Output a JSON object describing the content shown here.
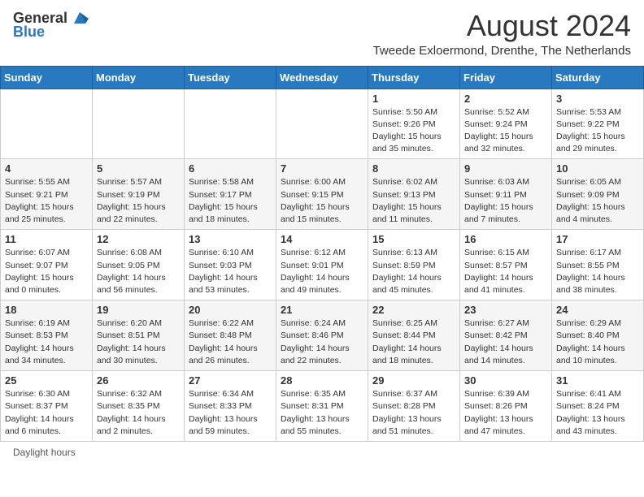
{
  "header": {
    "logo_general": "General",
    "logo_blue": "Blue",
    "main_title": "August 2024",
    "subtitle": "Tweede Exloermond, Drenthe, The Netherlands"
  },
  "days_of_week": [
    "Sunday",
    "Monday",
    "Tuesday",
    "Wednesday",
    "Thursday",
    "Friday",
    "Saturday"
  ],
  "weeks": [
    [
      {
        "day": "",
        "sunrise": "",
        "sunset": "",
        "daylight": ""
      },
      {
        "day": "",
        "sunrise": "",
        "sunset": "",
        "daylight": ""
      },
      {
        "day": "",
        "sunrise": "",
        "sunset": "",
        "daylight": ""
      },
      {
        "day": "",
        "sunrise": "",
        "sunset": "",
        "daylight": ""
      },
      {
        "day": "1",
        "sunrise": "Sunrise: 5:50 AM",
        "sunset": "Sunset: 9:26 PM",
        "daylight": "Daylight: 15 hours and 35 minutes."
      },
      {
        "day": "2",
        "sunrise": "Sunrise: 5:52 AM",
        "sunset": "Sunset: 9:24 PM",
        "daylight": "Daylight: 15 hours and 32 minutes."
      },
      {
        "day": "3",
        "sunrise": "Sunrise: 5:53 AM",
        "sunset": "Sunset: 9:22 PM",
        "daylight": "Daylight: 15 hours and 29 minutes."
      }
    ],
    [
      {
        "day": "4",
        "sunrise": "Sunrise: 5:55 AM",
        "sunset": "Sunset: 9:21 PM",
        "daylight": "Daylight: 15 hours and 25 minutes."
      },
      {
        "day": "5",
        "sunrise": "Sunrise: 5:57 AM",
        "sunset": "Sunset: 9:19 PM",
        "daylight": "Daylight: 15 hours and 22 minutes."
      },
      {
        "day": "6",
        "sunrise": "Sunrise: 5:58 AM",
        "sunset": "Sunset: 9:17 PM",
        "daylight": "Daylight: 15 hours and 18 minutes."
      },
      {
        "day": "7",
        "sunrise": "Sunrise: 6:00 AM",
        "sunset": "Sunset: 9:15 PM",
        "daylight": "Daylight: 15 hours and 15 minutes."
      },
      {
        "day": "8",
        "sunrise": "Sunrise: 6:02 AM",
        "sunset": "Sunset: 9:13 PM",
        "daylight": "Daylight: 15 hours and 11 minutes."
      },
      {
        "day": "9",
        "sunrise": "Sunrise: 6:03 AM",
        "sunset": "Sunset: 9:11 PM",
        "daylight": "Daylight: 15 hours and 7 minutes."
      },
      {
        "day": "10",
        "sunrise": "Sunrise: 6:05 AM",
        "sunset": "Sunset: 9:09 PM",
        "daylight": "Daylight: 15 hours and 4 minutes."
      }
    ],
    [
      {
        "day": "11",
        "sunrise": "Sunrise: 6:07 AM",
        "sunset": "Sunset: 9:07 PM",
        "daylight": "Daylight: 15 hours and 0 minutes."
      },
      {
        "day": "12",
        "sunrise": "Sunrise: 6:08 AM",
        "sunset": "Sunset: 9:05 PM",
        "daylight": "Daylight: 14 hours and 56 minutes."
      },
      {
        "day": "13",
        "sunrise": "Sunrise: 6:10 AM",
        "sunset": "Sunset: 9:03 PM",
        "daylight": "Daylight: 14 hours and 53 minutes."
      },
      {
        "day": "14",
        "sunrise": "Sunrise: 6:12 AM",
        "sunset": "Sunset: 9:01 PM",
        "daylight": "Daylight: 14 hours and 49 minutes."
      },
      {
        "day": "15",
        "sunrise": "Sunrise: 6:13 AM",
        "sunset": "Sunset: 8:59 PM",
        "daylight": "Daylight: 14 hours and 45 minutes."
      },
      {
        "day": "16",
        "sunrise": "Sunrise: 6:15 AM",
        "sunset": "Sunset: 8:57 PM",
        "daylight": "Daylight: 14 hours and 41 minutes."
      },
      {
        "day": "17",
        "sunrise": "Sunrise: 6:17 AM",
        "sunset": "Sunset: 8:55 PM",
        "daylight": "Daylight: 14 hours and 38 minutes."
      }
    ],
    [
      {
        "day": "18",
        "sunrise": "Sunrise: 6:19 AM",
        "sunset": "Sunset: 8:53 PM",
        "daylight": "Daylight: 14 hours and 34 minutes."
      },
      {
        "day": "19",
        "sunrise": "Sunrise: 6:20 AM",
        "sunset": "Sunset: 8:51 PM",
        "daylight": "Daylight: 14 hours and 30 minutes."
      },
      {
        "day": "20",
        "sunrise": "Sunrise: 6:22 AM",
        "sunset": "Sunset: 8:48 PM",
        "daylight": "Daylight: 14 hours and 26 minutes."
      },
      {
        "day": "21",
        "sunrise": "Sunrise: 6:24 AM",
        "sunset": "Sunset: 8:46 PM",
        "daylight": "Daylight: 14 hours and 22 minutes."
      },
      {
        "day": "22",
        "sunrise": "Sunrise: 6:25 AM",
        "sunset": "Sunset: 8:44 PM",
        "daylight": "Daylight: 14 hours and 18 minutes."
      },
      {
        "day": "23",
        "sunrise": "Sunrise: 6:27 AM",
        "sunset": "Sunset: 8:42 PM",
        "daylight": "Daylight: 14 hours and 14 minutes."
      },
      {
        "day": "24",
        "sunrise": "Sunrise: 6:29 AM",
        "sunset": "Sunset: 8:40 PM",
        "daylight": "Daylight: 14 hours and 10 minutes."
      }
    ],
    [
      {
        "day": "25",
        "sunrise": "Sunrise: 6:30 AM",
        "sunset": "Sunset: 8:37 PM",
        "daylight": "Daylight: 14 hours and 6 minutes."
      },
      {
        "day": "26",
        "sunrise": "Sunrise: 6:32 AM",
        "sunset": "Sunset: 8:35 PM",
        "daylight": "Daylight: 14 hours and 2 minutes."
      },
      {
        "day": "27",
        "sunrise": "Sunrise: 6:34 AM",
        "sunset": "Sunset: 8:33 PM",
        "daylight": "Daylight: 13 hours and 59 minutes."
      },
      {
        "day": "28",
        "sunrise": "Sunrise: 6:35 AM",
        "sunset": "Sunset: 8:31 PM",
        "daylight": "Daylight: 13 hours and 55 minutes."
      },
      {
        "day": "29",
        "sunrise": "Sunrise: 6:37 AM",
        "sunset": "Sunset: 8:28 PM",
        "daylight": "Daylight: 13 hours and 51 minutes."
      },
      {
        "day": "30",
        "sunrise": "Sunrise: 6:39 AM",
        "sunset": "Sunset: 8:26 PM",
        "daylight": "Daylight: 13 hours and 47 minutes."
      },
      {
        "day": "31",
        "sunrise": "Sunrise: 6:41 AM",
        "sunset": "Sunset: 8:24 PM",
        "daylight": "Daylight: 13 hours and 43 minutes."
      }
    ]
  ],
  "legend": {
    "daylight_hours": "Daylight hours"
  }
}
